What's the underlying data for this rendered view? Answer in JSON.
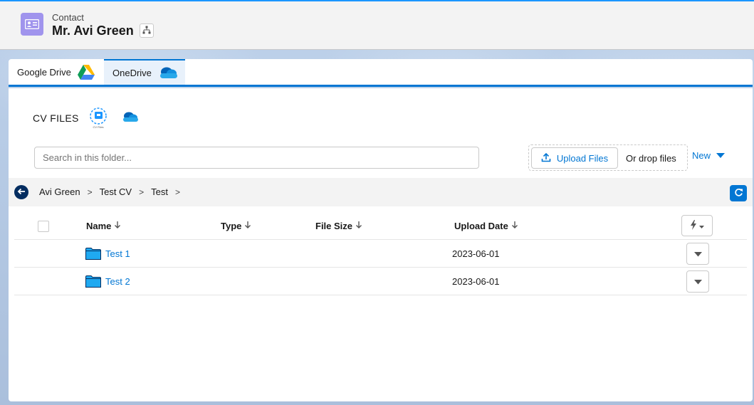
{
  "header": {
    "record_type": "Contact",
    "record_name": "Mr. Avi Green",
    "record_icon": "contact-card-icon",
    "hierarchy_icon": "hierarchy-icon"
  },
  "tabs": [
    {
      "label": "Google Drive",
      "icon": "google-drive-icon",
      "active": false
    },
    {
      "label": "OneDrive",
      "icon": "onedrive-icon",
      "active": true
    }
  ],
  "card": {
    "title": "CV FILES",
    "cv_icon_caption": "CV Files"
  },
  "search": {
    "placeholder": "Search in this folder..."
  },
  "upload": {
    "button_label": "Upload Files",
    "drop_label": "Or drop files"
  },
  "new_menu": {
    "label": "New"
  },
  "breadcrumb": [
    "Avi Green",
    "Test CV",
    "Test"
  ],
  "breadcrumb_separator": ">",
  "table": {
    "columns": [
      "Name",
      "Type",
      "File Size",
      "Upload Date"
    ],
    "rows": [
      {
        "name": "Test 1",
        "type": "",
        "size": "",
        "date": "2023-06-01"
      },
      {
        "name": "Test 2",
        "type": "",
        "size": "",
        "date": "2023-06-01"
      }
    ]
  },
  "colors": {
    "brand": "#0176d3",
    "contact_icon_bg": "#a094ed",
    "folder": "#1fa9f1",
    "nav_dark": "#032d60"
  }
}
